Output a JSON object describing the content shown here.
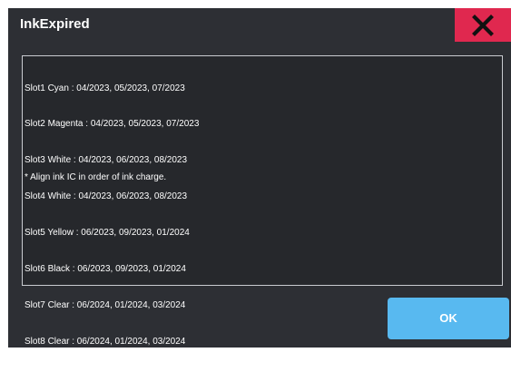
{
  "dialog": {
    "title": "InkExpired",
    "close_icon": "close-icon",
    "lines": [
      "Slot1 Cyan : 04/2023, 05/2023, 07/2023",
      "Slot2 Magenta : 04/2023, 05/2023, 07/2023",
      "Slot3 White : 04/2023, 06/2023, 08/2023",
      "Slot4 White : 04/2023, 06/2023, 08/2023",
      "Slot5 Yellow : 06/2023, 09/2023, 01/2024",
      "Slot6 Black : 06/2023, 09/2023, 01/2024",
      "Slot7 Clear : 06/2024, 01/2024, 03/2024",
      "Slot8 Clear : 06/2024, 01/2024, 03/2024"
    ],
    "note": "* Align ink IC in order of ink charge.",
    "ok_label": "OK"
  },
  "colors": {
    "background": "#2d2f34",
    "close_button": "#e0284f",
    "ok_button": "#58b9f0",
    "text": "#ffffff"
  }
}
